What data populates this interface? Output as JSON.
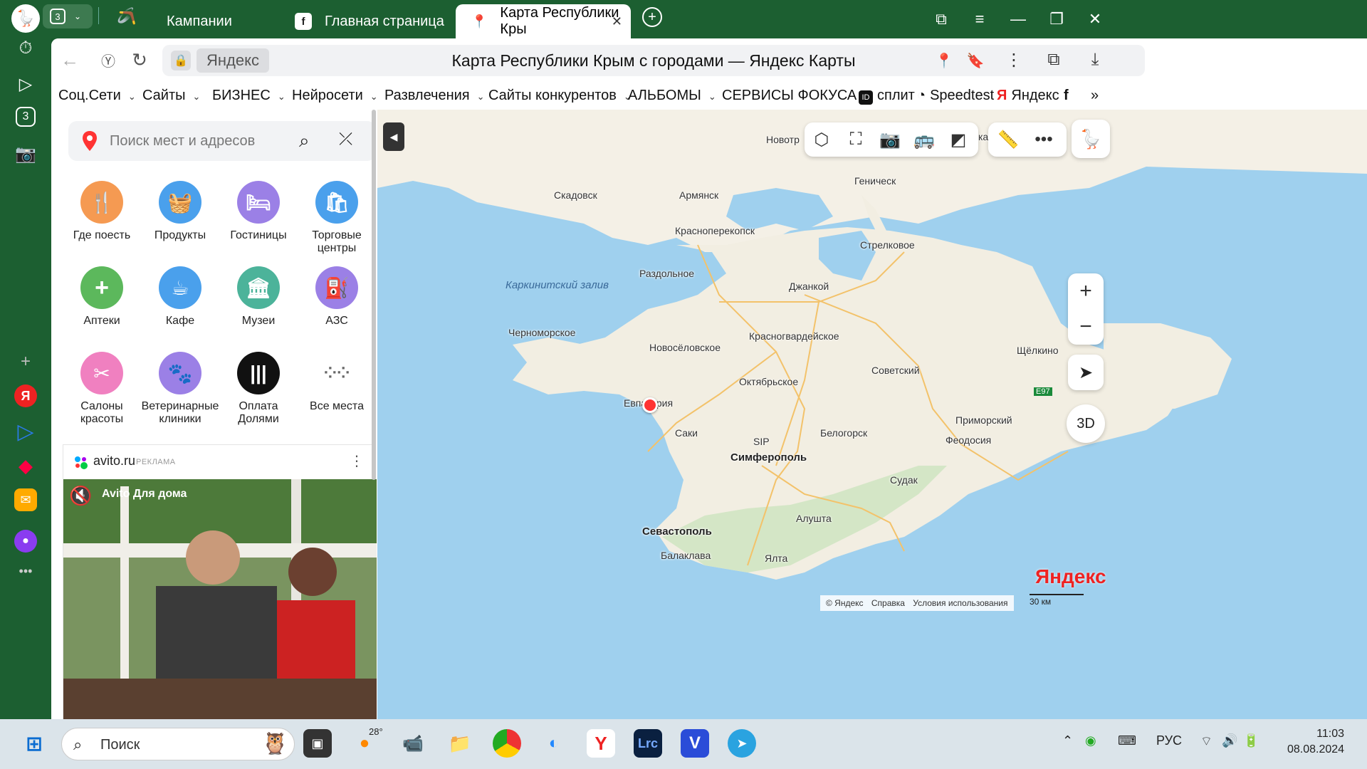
{
  "tabs": {
    "tab_count": "3",
    "tab1": "Кампании",
    "tab2": "Главная страница",
    "tab3": "Карта Республики Кры"
  },
  "address": {
    "site": "Яндекс",
    "title": "Карта Республики Крым с городами — Яндекс Карты"
  },
  "bookmarks": [
    "Соц.Сети",
    "Сайты",
    "БИЗНЕС",
    "Нейросети",
    "Развлечения",
    "Сайты конкурентов",
    "АЛЬБОМЫ",
    "СЕРВИСЫ ФОКУСА",
    "сплит",
    "Speedtest",
    "Яндекс"
  ],
  "search": {
    "placeholder": "Поиск мест и адресов"
  },
  "categories": [
    {
      "label": "Где поесть",
      "color": "#f59a52"
    },
    {
      "label": "Продукты",
      "color": "#4aa0ec"
    },
    {
      "label": "Гостиницы",
      "color": "#9b80e6"
    },
    {
      "label": "Торговые центры",
      "color": "#4aa0ec"
    },
    {
      "label": "Аптеки",
      "color": "#5cb85c"
    },
    {
      "label": "Кафе",
      "color": "#4aa0ec"
    },
    {
      "label": "Музеи",
      "color": "#4cb39a"
    },
    {
      "label": "АЗС",
      "color": "#9b80e6"
    },
    {
      "label": "Салоны красоты",
      "color": "#f080c0"
    },
    {
      "label": "Ветеринарные клиники",
      "color": "#9b80e6"
    },
    {
      "label": "Оплата Долями",
      "color": "#111111"
    },
    {
      "label": "Все места",
      "color": "#ffffff"
    }
  ],
  "ad": {
    "name": "avito.ru",
    "tag": "РЕКЛАМА",
    "brand": "Avito Для дома"
  },
  "map": {
    "water_label": "Каркинитский залив",
    "cities": {
      "novotr": "Новотр",
      "skadovsk": "Скадовск",
      "armyansk": "Армянск",
      "genichesk": "Геническ",
      "krasnoperekopsk": "Красноперекопск",
      "strelkovoe": "Стрелковое",
      "razdolnoe": "Раздольное",
      "dzhankoy": "Джанкой",
      "chernomorskoe": "Черноморское",
      "krasnogvardeyskoe": "Красногвардейское",
      "novoselovskoe": "Новосёловское",
      "shchelkino": "Щёлкино",
      "sovetskiy": "Советский",
      "oktyabrskoe": "Октябрьское",
      "evpatoriya": "Евпатория",
      "e97": "E97",
      "primorskiy": "Приморский",
      "saki": "Саки",
      "sip": "SIP",
      "belogorsk": "Белогорск",
      "feodosiya": "Феодосия",
      "simferopol": "Симферополь",
      "sudak": "Судак",
      "alushta": "Алушта",
      "sevastopol": "Севастополь",
      "balaklava": "Балаклава",
      "yalta": "Ялта",
      "ka": "ка"
    },
    "btn3d": "3D",
    "logo": "Яндекс",
    "copyright": "© Яндекс",
    "help": "Справка",
    "terms": "Условия использования",
    "scale": "30 км"
  },
  "taskbar": {
    "search": "Поиск",
    "weather": "28°",
    "lang": "РУС",
    "time": "11:03",
    "date": "08.08.2024"
  }
}
